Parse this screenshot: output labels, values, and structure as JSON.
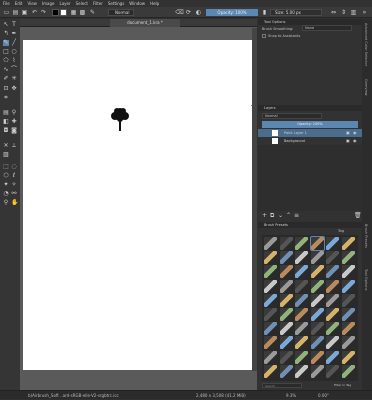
{
  "menu": [
    "File",
    "Edit",
    "View",
    "Image",
    "Layer",
    "Select",
    "Filter",
    "Settings",
    "Window",
    "Help"
  ],
  "toolbar": {
    "blend_mode": "Normal",
    "opacity_label": "Opacity: 100%",
    "size_label": "Size: 5.00 px"
  },
  "document": {
    "tab_title": "document_1.kra *"
  },
  "tool_options": {
    "title": "Tool Options",
    "mode_label": "Brush Smoothing:",
    "mode_value": "None",
    "snap_label": "Snap to Assistants"
  },
  "layers": {
    "title": "Layers",
    "blend": "Normal",
    "opacity": "Opacity: 100%",
    "items": [
      {
        "name": "Paint Layer 1",
        "selected": true
      },
      {
        "name": "Background",
        "selected": false
      }
    ]
  },
  "brush_presets": {
    "title": "Brush Presets",
    "tag_label": "Tag",
    "search_placeholder": "Search",
    "filter_label": "Filter in Tag"
  },
  "right_strip": [
    "Advanced Color Selector",
    "Overview",
    "Brush Presets",
    "Tool Options"
  ],
  "status": {
    "left": "b)Airbrush_Soft  ..ard-sRGB-elle-V2-srgbtrc.icc",
    "center": "2,480 x 3,508 (41.2 MiB)",
    "zoom": "9.3%",
    "angle": "0.00°"
  },
  "colors": {
    "accent": "#5b87b0",
    "fg_swatch": "#000000",
    "bg_swatch": "#ffffff",
    "brush_sample": "#7aa8d8"
  }
}
